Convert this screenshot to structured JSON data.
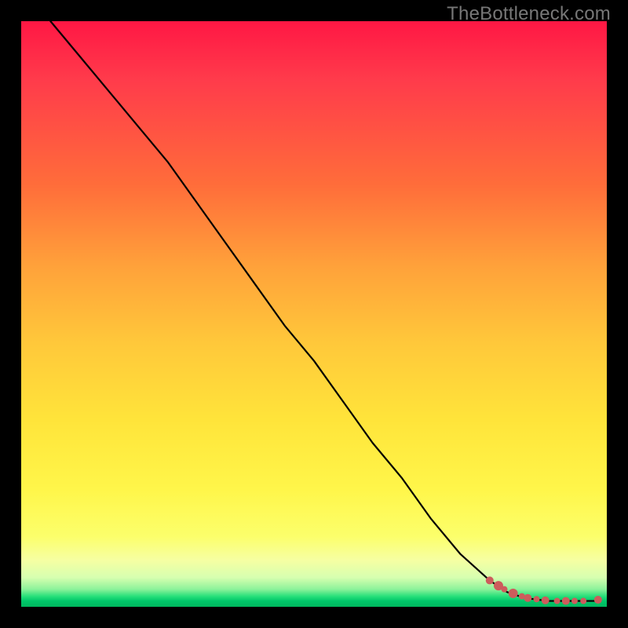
{
  "watermark": "TheBottleneck.com",
  "chart_data": {
    "type": "line",
    "title": "",
    "xlabel": "",
    "ylabel": "",
    "xlim": [
      0,
      100
    ],
    "ylim": [
      0,
      100
    ],
    "grid": false,
    "legend": false,
    "series": [
      {
        "name": "curve",
        "style": "line",
        "color": "#000000",
        "x": [
          5,
          10,
          15,
          20,
          25,
          30,
          35,
          40,
          45,
          50,
          55,
          60,
          65,
          70,
          75,
          80,
          83,
          86,
          90,
          94,
          98
        ],
        "y": [
          100,
          94,
          88,
          82,
          76,
          69,
          62,
          55,
          48,
          42,
          35,
          28,
          22,
          15,
          9,
          4.5,
          2.5,
          1.5,
          1,
          1,
          1
        ]
      },
      {
        "name": "markers",
        "style": "scatter",
        "color": "#cd5c5c",
        "x": [
          80,
          81.5,
          82.5,
          84,
          85.5,
          86.5,
          88,
          89.5,
          91.5,
          93,
          94.5,
          96,
          98.5
        ],
        "y": [
          4.5,
          3.6,
          3.0,
          2.3,
          1.8,
          1.5,
          1.3,
          1.1,
          1.0,
          1.0,
          1.0,
          1.0,
          1.2
        ],
        "r": [
          5,
          6,
          4,
          6,
          4,
          5,
          4,
          5,
          4,
          5,
          4,
          4,
          5
        ]
      }
    ]
  }
}
